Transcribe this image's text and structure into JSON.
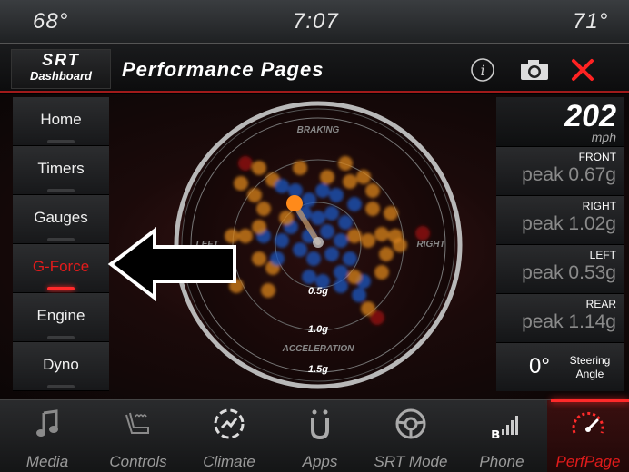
{
  "status": {
    "temp_left": "68°",
    "time": "7:07",
    "temp_right": "71°"
  },
  "header": {
    "logo_top": "SRT",
    "logo_bottom": "Dashboard",
    "title": "Performance Pages",
    "info_icon": "info-icon",
    "camera_icon": "camera-icon",
    "close_icon": "close-x-icon"
  },
  "menu": [
    {
      "label": "Home"
    },
    {
      "label": "Timers"
    },
    {
      "label": "Gauges"
    },
    {
      "label": "G-Force"
    },
    {
      "label": "Engine"
    },
    {
      "label": "Dyno"
    }
  ],
  "active_menu": "G-Force",
  "gforce": {
    "top": "BRAKING",
    "left": "LEFT",
    "right": "RIGHT",
    "bottom": "ACCELERATION",
    "ring1": "0.5g",
    "ring2": "1.0g",
    "ring3": "1.5g"
  },
  "stats": {
    "speed": "202",
    "speed_unit": "mph",
    "peaks": [
      {
        "label": "FRONT",
        "value": "peak 0.67g"
      },
      {
        "label": "RIGHT",
        "value": "peak 1.02g"
      },
      {
        "label": "LEFT",
        "value": "peak 0.53g"
      },
      {
        "label": "REAR",
        "value": "peak 1.14g"
      }
    ],
    "steering_value": "0°",
    "steering_label": "Steering Angle"
  },
  "nav": [
    {
      "label": "Media",
      "icon": "music-note-icon"
    },
    {
      "label": "Controls",
      "icon": "seat-icon"
    },
    {
      "label": "Climate",
      "icon": "climate-icon"
    },
    {
      "label": "Apps",
      "icon": "apps-icon"
    },
    {
      "label": "SRT Mode",
      "icon": "steering-wheel-icon"
    },
    {
      "label": "Phone",
      "icon": "phone-signal-icon"
    },
    {
      "label": "PerfPage",
      "icon": "speedometer-icon"
    }
  ],
  "colors": {
    "accent": "#e21b1b",
    "dot_orange": "#d8841e",
    "dot_blue": "#1a56c0",
    "dot_red": "#9a1010"
  }
}
